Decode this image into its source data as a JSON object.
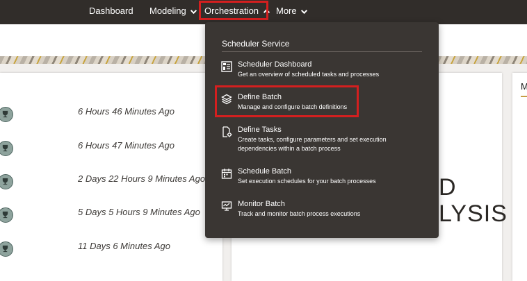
{
  "nav": {
    "items": [
      {
        "label": "Dashboard",
        "has_dropdown": false
      },
      {
        "label": "Modeling",
        "has_dropdown": true
      },
      {
        "label": "Orchestration",
        "has_dropdown": true,
        "expanded": true
      },
      {
        "label": "More",
        "has_dropdown": true
      }
    ]
  },
  "activity": {
    "items": [
      {
        "time": "6 Hours 46 Minutes Ago",
        "icon": "trophy-icon"
      },
      {
        "time": "6 Hours 47 Minutes Ago",
        "icon": "trophy-icon"
      },
      {
        "time": "2 Days 22 Hours 9 Minutes Ago",
        "icon": "trophy-icon"
      },
      {
        "time": "5 Days 5 Hours 9 Minutes Ago",
        "icon": "trophy-icon"
      },
      {
        "time": "11 Days 6 Minutes Ago",
        "icon": "trophy-icon"
      }
    ]
  },
  "middle_card": {
    "line1": "D",
    "line2": "LYSIS"
  },
  "right_card": {
    "tab": "M"
  },
  "dropdown": {
    "heading": "Scheduler Service",
    "items": [
      {
        "title": "Scheduler Dashboard",
        "desc": "Get an overview of scheduled tasks and processes",
        "icon": "dashboard-icon"
      },
      {
        "title": "Define Batch",
        "desc": "Manage and configure batch definitions",
        "icon": "layers-icon"
      },
      {
        "title": "Define Tasks",
        "desc": "Create tasks, configure parameters and set execution dependencies within a batch process",
        "icon": "task-settings-icon"
      },
      {
        "title": "Schedule Batch",
        "desc": "Set execution schedules for your batch processes",
        "icon": "calendar-icon"
      },
      {
        "title": "Monitor Batch",
        "desc": "Track and monitor batch process executions",
        "icon": "monitor-icon"
      }
    ]
  },
  "colors": {
    "topbar": "#312d2a",
    "dropdown_bg": "#3a3633",
    "highlight": "#d41f1f",
    "accent": "#c69c45"
  }
}
